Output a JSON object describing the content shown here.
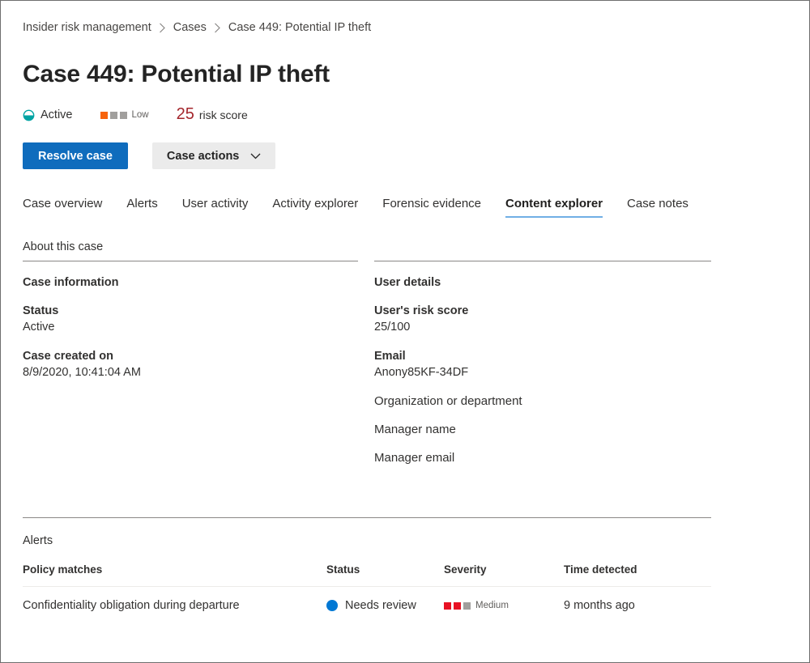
{
  "breadcrumb": {
    "items": [
      {
        "label": "Insider risk management"
      },
      {
        "label": "Cases"
      },
      {
        "label": "Case 449: Potential IP theft"
      }
    ],
    "separator_icon": "chevron-right-icon"
  },
  "header": {
    "title": "Case 449: Potential IP theft",
    "status": {
      "icon": "half-filled-circle-icon",
      "label": "Active",
      "color": "#00a3a3"
    },
    "severity": {
      "icon": "severity-squares-icon",
      "label": "Low",
      "filled": 1,
      "total": 3,
      "fill_color": "#f7630c",
      "empty_color": "#a19f9d"
    },
    "risk_score": {
      "value": "25",
      "label": "risk score",
      "color": "#a4262c"
    }
  },
  "toolbar": {
    "resolve_label": "Resolve case",
    "resolve_color": "#0f6cbd",
    "case_actions_label": "Case actions",
    "case_actions_icon": "chevron-down-icon"
  },
  "tabs": {
    "active": "Content explorer",
    "accent_color": "#71afe5",
    "items": [
      {
        "label": "Case overview",
        "active": false
      },
      {
        "label": "Alerts",
        "active": false
      },
      {
        "label": "User activity",
        "active": false
      },
      {
        "label": "Activity explorer",
        "active": false
      },
      {
        "label": "Forensic evidence",
        "active": false
      },
      {
        "label": "Content explorer",
        "active": true
      },
      {
        "label": "Case notes",
        "active": false
      }
    ]
  },
  "about": {
    "heading": "About this case",
    "left": {
      "heading": "Case information",
      "fields": [
        {
          "label": "Status",
          "value": "Active"
        },
        {
          "label": "Case created on",
          "value": "8/9/2020, 10:41:04 AM"
        }
      ]
    },
    "right": {
      "heading": "User details",
      "fields": [
        {
          "label": "User's risk score",
          "value": "25/100"
        },
        {
          "label": "Email",
          "value": "Anony85KF-34DF"
        },
        {
          "label": "Organization or department",
          "value": ""
        },
        {
          "label": "Manager name",
          "value": ""
        },
        {
          "label": "Manager email",
          "value": ""
        }
      ]
    }
  },
  "alerts": {
    "heading": "Alerts",
    "columns": [
      "Policy matches",
      "Status",
      "Severity",
      "Time detected"
    ],
    "rows": [
      {
        "policy": "Confidentiality obligation during departure",
        "status": "Needs review",
        "status_color": "#0078d4",
        "severity": "Medium",
        "severity_filled": 2,
        "severity_total": 3,
        "severity_fill_color": "#e81123",
        "severity_empty_color": "#a19f9d",
        "time": "9 months ago"
      }
    ]
  }
}
